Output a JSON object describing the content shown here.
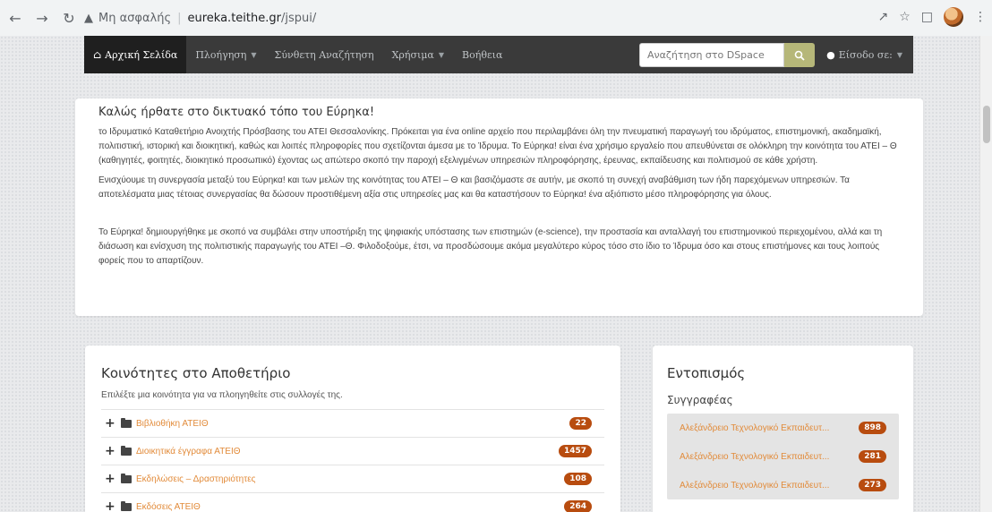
{
  "browser": {
    "insecure_label": "Μη ασφαλής",
    "host": "eureka.teithe.gr",
    "path": "/jspui/"
  },
  "navbar": {
    "home": "Αρχική Σελίδα",
    "browse": "Πλοήγηση",
    "advanced_search": "Σύνθετη Αναζήτηση",
    "useful": "Χρήσιμα",
    "help": "Βοήθεια",
    "search_placeholder": "Αναζήτηση στο DSpace",
    "login": "Είσοδο σε:"
  },
  "welcome": {
    "title": "Καλώς ήρθατε στο δικτυακό τόπο του Εύρηκα!",
    "p1": "το Ιδρυματικό Καταθετήριο Ανοιχτής Πρόσβασης του ΑΤΕΙ Θεσσαλονίκης. Πρόκειται για ένα online αρχείο που περιλαμβάνει όλη την πνευματική παραγωγή του ιδρύματος, επιστημονική, ακαδημαϊκή, πολιτιστική, ιστορική και διοικητική, καθώς και λοιπές πληροφορίες που σχετίζονται άμεσα με το Ίδρυμα. Το Εύρηκα! είναι ένα χρήσιμο εργαλείο που απευθύνεται σε ολόκληρη την κοινότητα του ΑΤΕΙ – Θ (καθηγητές, φοιτητές, διοικητικό προσωπικό) έχοντας ως απώτερο σκοπό την παροχή εξελιγμένων υπηρεσιών πληροφόρησης, έρευνας, εκπαίδευσης και πολιτισμού σε κάθε χρήστη.",
    "p2": "Ενισχύουμε τη συνεργασία μεταξύ του Εύρηκα! και των μελών της κοινότητας του ΑΤΕΙ – Θ και βασιζόμαστε σε αυτήν, με σκοπό τη συνεχή αναβάθμιση των ήδη παρεχόμενων υπηρεσιών. Τα αποτελέσματα μιας τέτοιας συνεργασίας θα δώσουν προστιθέμενη αξία στις υπηρεσίες μας και θα καταστήσουν το Εύρηκα! ένα αξιόπιστο μέσο πληροφόρησης για όλους.",
    "p3": "Το Εύρηκα! δημιουργήθηκε με σκοπό να συμβάλει στην υποστήριξη της ψηφιακής υπόστασης των επιστημών (e-science), την προστασία και ανταλλαγή του επιστημονικού περιεχομένου, αλλά και τη διάσωση και ενίσχυση της πολιτιστικής παραγωγής του ΑΤΕΙ –Θ. Φιλοδοξούμε, έτσι, να προσδώσουμε ακόμα μεγαλύτερο κύρος τόσο στο ίδιο το Ίδρυμα όσο και στους επιστήμονες και τους λοιπούς φορείς που το απαρτίζουν."
  },
  "communities": {
    "title": "Κοινότητες στο Αποθετήριο",
    "subtitle": "Επιλέξτε μια κοινότητα για να πλοηγηθείτε στις συλλογές της.",
    "items": [
      {
        "label": "Βιβλιοθήκη ΑΤΕΙΘ",
        "count": "22"
      },
      {
        "label": "Διοικητικά έγγραφα ΑΤΕΙΘ",
        "count": "1457"
      },
      {
        "label": "Εκδηλώσεις – Δραστηριότητες",
        "count": "108"
      },
      {
        "label": "Εκδόσεις ΑΤΕΙΘ",
        "count": "264"
      }
    ]
  },
  "location": {
    "title": "Εντοπισμός",
    "subtitle": "Συγγραφέας",
    "items": [
      {
        "label": "Αλεξάνδρειο Τεχνολογικό Εκπαιδευτ...",
        "count": "898"
      },
      {
        "label": "Αλεξάνδρειο Τεχνολογικό Εκπαιδευτ...",
        "count": "281"
      },
      {
        "label": "Αλεξάνδρειο Τεχνολογικό Εκπαιδευτ...",
        "count": "273"
      }
    ]
  },
  "colors": {
    "navbar_bg": "#3a3a3a",
    "link_orange": "#e28b3a",
    "badge_bg": "#b84c0f",
    "search_btn": "#b6b779"
  }
}
